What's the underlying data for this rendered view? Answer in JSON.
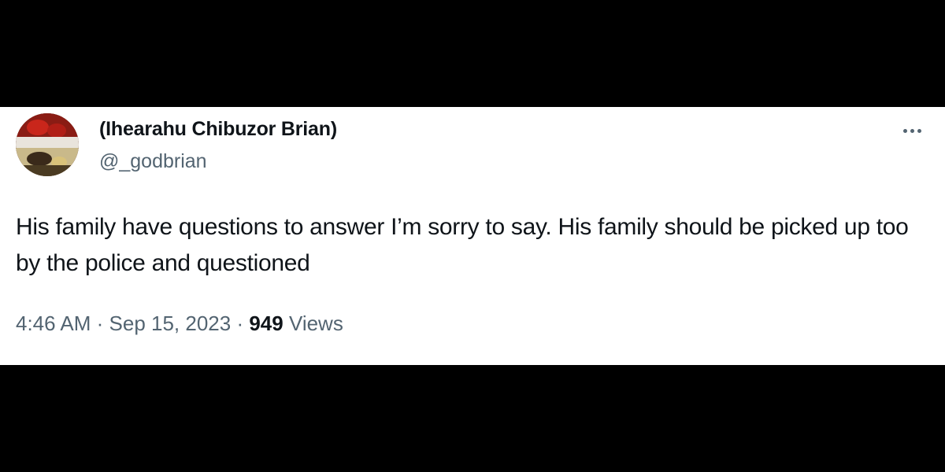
{
  "tweet": {
    "author": {
      "display_name": "(Ihearahu Chibuzor Brian)",
      "handle": "@_godbrian"
    },
    "text": "His family have questions to answer I’m sorry to say. His family should be picked up too by the police and questioned",
    "timestamp": "4:46 AM",
    "separator": " · ",
    "date": "Sep 15, 2023",
    "views_count": "949",
    "views_label": " Views"
  },
  "icons": {
    "more": "more-options-icon",
    "avatar": "profile-avatar"
  },
  "colors": {
    "background": "#000000",
    "card": "#ffffff",
    "primary_text": "#0f1419",
    "secondary_text": "#536471"
  }
}
